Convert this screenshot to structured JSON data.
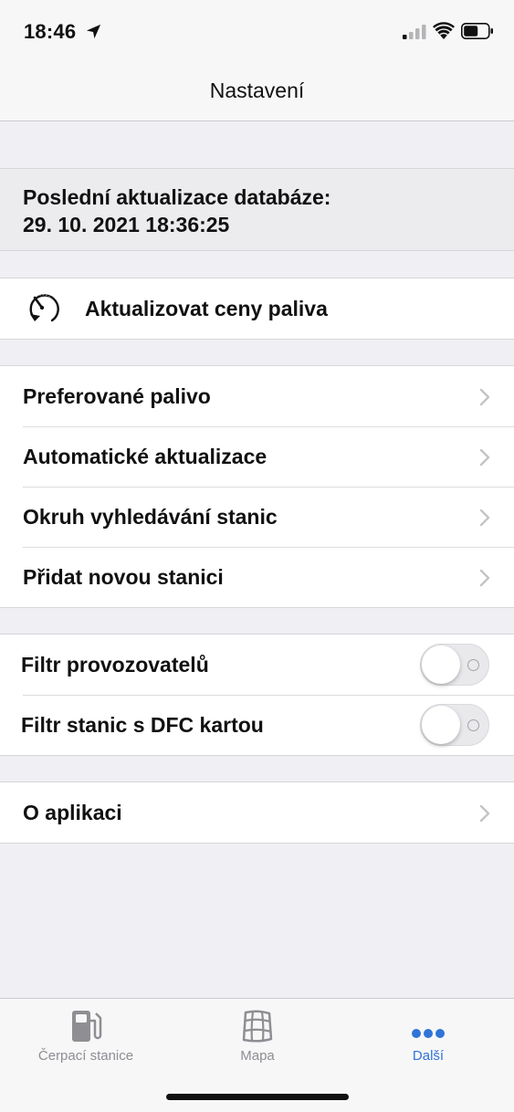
{
  "status": {
    "time": "18:46"
  },
  "nav": {
    "title": "Nastavení"
  },
  "info": {
    "line1": "Poslední aktualizace databáze:",
    "line2": "29. 10. 2021 18:36:25"
  },
  "update": {
    "label": "Aktualizovat ceny paliva",
    "icon": "gauge-refresh-icon"
  },
  "settings": [
    {
      "label": "Preferované palivo"
    },
    {
      "label": "Automatické aktualizace"
    },
    {
      "label": "Okruh vyhledávání stanic"
    },
    {
      "label": "Přidat novou stanici"
    }
  ],
  "filters": [
    {
      "label": "Filtr provozovatelů",
      "enabled": false
    },
    {
      "label": "Filtr stanic s DFC kartou",
      "enabled": false
    }
  ],
  "about": {
    "label": "O aplikaci"
  },
  "tabs": [
    {
      "label": "Čerpací stanice",
      "icon": "fuel-pump-icon",
      "active": false
    },
    {
      "label": "Mapa",
      "icon": "map-grid-icon",
      "active": false
    },
    {
      "label": "Další",
      "icon": "more-dots-icon",
      "active": true
    }
  ],
  "colors": {
    "accent": "#2f74d6",
    "background": "#efeff4",
    "inactive": "#8e8e93"
  }
}
